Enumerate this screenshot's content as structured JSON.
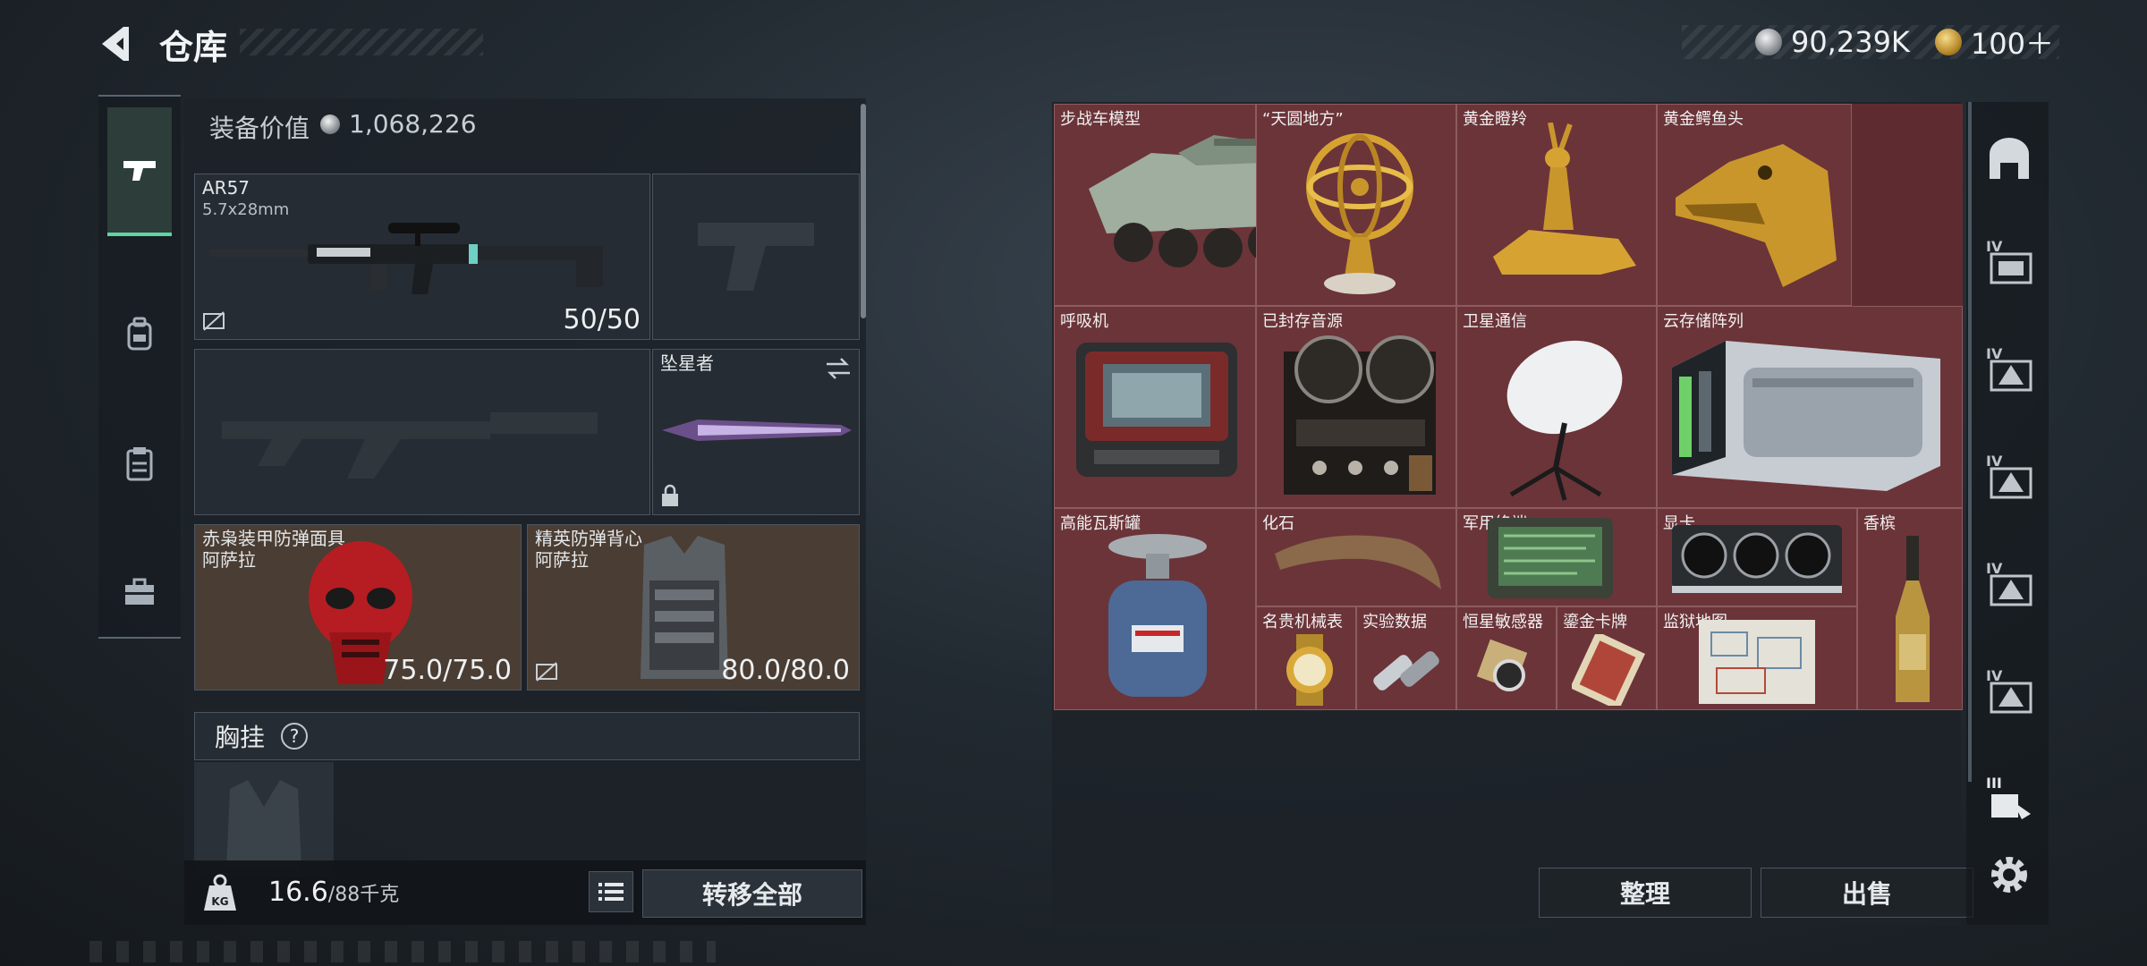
{
  "header": {
    "title": "仓库",
    "currency_silver": "90,239K",
    "currency_gold": "100＋"
  },
  "side_tabs": [
    {
      "name": "weapon-tab-icon",
      "active": true
    },
    {
      "name": "backpack-tab-icon",
      "active": false
    },
    {
      "name": "clipboard-tab-icon",
      "active": false
    },
    {
      "name": "toolbox-tab-icon",
      "active": false
    }
  ],
  "equipment": {
    "value_label": "装备价值",
    "value": "1,068,226",
    "primary_weapon": {
      "name": "AR57",
      "caliber": "5.7x28mm",
      "durability": "50/50"
    },
    "melee": {
      "name": "坠星者"
    },
    "helmet": {
      "name": "赤枭装甲防弹面具",
      "origin": "阿萨拉",
      "durability": "75.0/75.0"
    },
    "armor": {
      "name": "精英防弹背心",
      "origin": "阿萨拉",
      "durability": "80.0/80.0"
    },
    "chest_rig_label": "胸挂",
    "chest_rig_help": "?"
  },
  "bottom": {
    "weight_icon_text": "KG",
    "weight_current": "16.6",
    "weight_max": "/88千克",
    "transfer_all": "转移全部"
  },
  "storage_items": [
    "步战车模型",
    "“天圆地方”",
    "黄金瞪羚",
    "黄金鳄鱼头",
    "呼吸机",
    "已封存音源",
    "卫星通信",
    "云存储阵列",
    "高能瓦斯罐",
    "化石",
    "军用终端",
    "显卡",
    "香槟",
    "名贵机械表",
    "实验数据",
    "恒星敏感器",
    "鎏金卡牌",
    "监狱地图"
  ],
  "storage_buttons": {
    "sort": "整理",
    "sell": "出售"
  },
  "rail": {
    "tier_labels": [
      "IV",
      "IV",
      "IV",
      "IV",
      "IV",
      "III"
    ]
  },
  "colors": {
    "accent_green": "#5fd3a6",
    "storage_red": "#6b3439",
    "slot_brown": "#4a3d33"
  }
}
